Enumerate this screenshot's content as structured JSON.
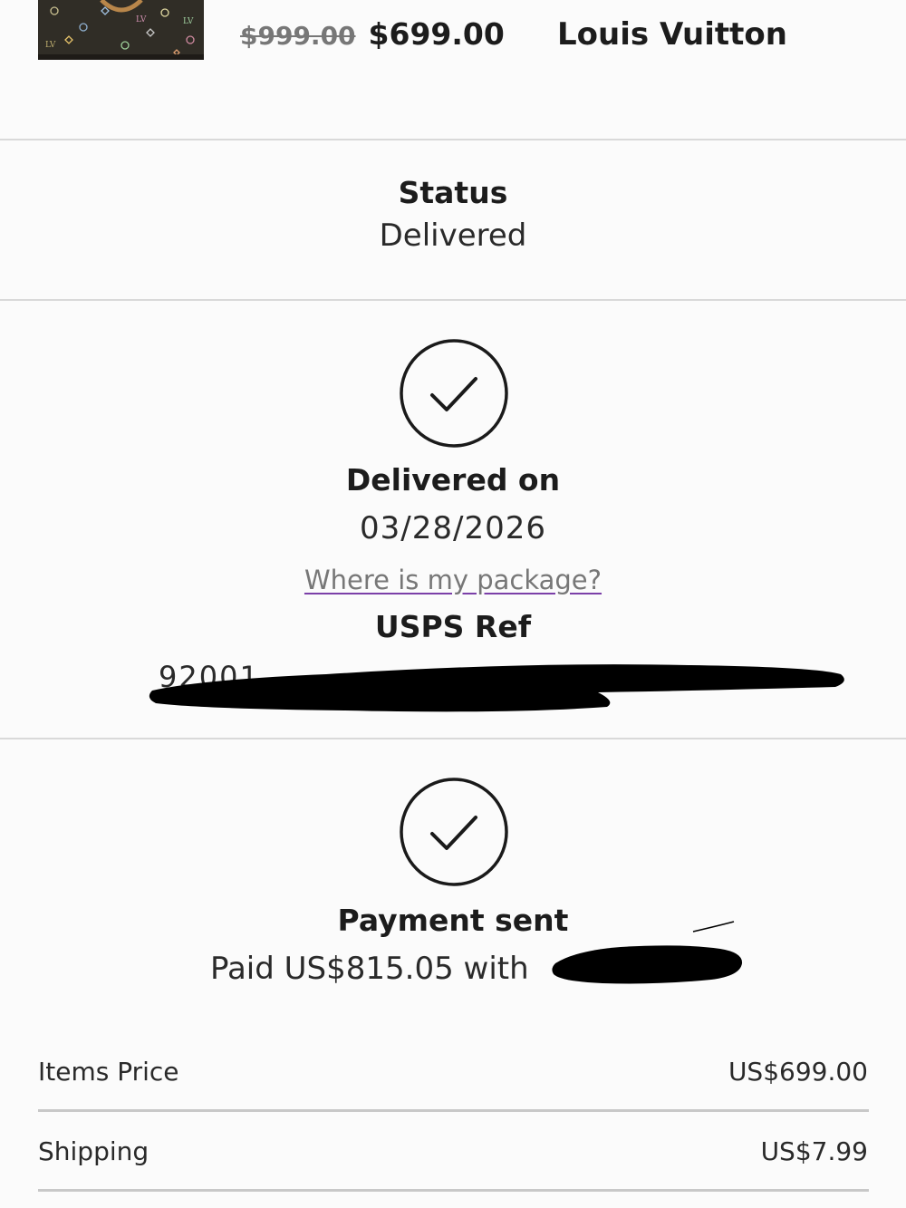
{
  "product": {
    "image_icon": "handbag-photo",
    "original_price": "$999.00",
    "sale_price": "$699.00",
    "brand": "Louis Vuitton"
  },
  "status": {
    "label": "Status",
    "value": "Delivered"
  },
  "delivery": {
    "icon": "check-circle-icon",
    "label": "Delivered on",
    "date": "03/28/2026",
    "link_text": "Where is my package?",
    "carrier_label": "USPS Ref",
    "tracking_visible_prefix": "92001",
    "redacted": true
  },
  "payment": {
    "icon": "check-circle-icon",
    "label": "Payment sent",
    "text": "Paid US$815.05 with",
    "redacted": true
  },
  "summary": [
    {
      "label": "Items Price",
      "value": "US$699.00"
    },
    {
      "label": "Shipping",
      "value": "US$7.99"
    }
  ],
  "colors": {
    "background": "#fbfbfb",
    "text": "#1c1c1c",
    "muted": "#777777",
    "link_underline": "#7b3fa8",
    "divider": "#d9d9d9"
  }
}
